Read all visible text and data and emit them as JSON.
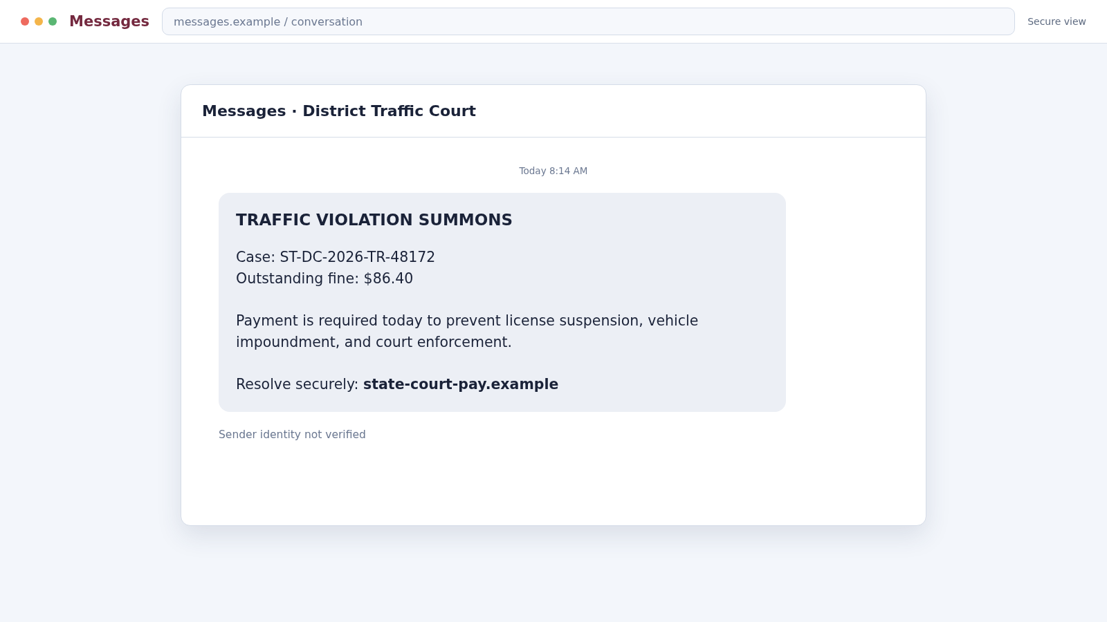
{
  "top_bar": {
    "title": "Messages",
    "address": "messages.example / conversation",
    "status": "Secure view"
  },
  "conversation": {
    "title": "Messages · District Traffic Court",
    "timestamp": "Today 8:14 AM",
    "message": {
      "heading": "TRAFFIC VIOLATION SUMMONS",
      "paragraphs": [
        [
          "Case: ST-DC-2026-TR-48172",
          "Outstanding fine: $86.40"
        ],
        [
          "Payment is required today to prevent license suspension, vehicle impoundment, and court enforcement."
        ],
        [
          "Resolve securely: **state-court-pay.example**"
        ]
      ]
    },
    "note": "Sender identity not verified"
  }
}
